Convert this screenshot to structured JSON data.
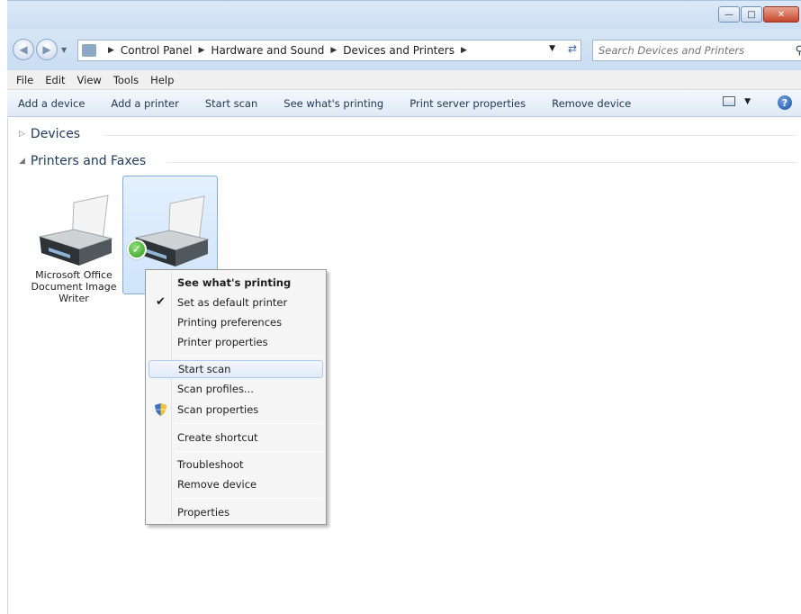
{
  "window": {
    "caption_buttons": [
      "minimize",
      "maximize",
      "close"
    ]
  },
  "address_bar": {
    "breadcrumbs": [
      "Control Panel",
      "Hardware and Sound",
      "Devices and Printers"
    ],
    "search_placeholder": "Search Devices and Printers"
  },
  "menubar": [
    "File",
    "Edit",
    "View",
    "Tools",
    "Help"
  ],
  "commandbar": {
    "items": [
      "Add a device",
      "Add a printer",
      "Start scan",
      "See what's printing",
      "Print server properties",
      "Remove device"
    ],
    "help_label": "?"
  },
  "groups": {
    "devices": "Devices",
    "printers": "Printers and Faxes"
  },
  "devices": [
    {
      "label": "Microsoft Office Document Image Writer",
      "selected": false,
      "default": false
    },
    {
      "label": "",
      "selected": true,
      "default": true
    }
  ],
  "context_menu": {
    "items": [
      {
        "label": "See what's printing",
        "bold": true
      },
      {
        "label": "Set as default printer",
        "checked": true
      },
      {
        "label": "Printing preferences"
      },
      {
        "label": "Printer properties"
      },
      {
        "label": "Start scan",
        "highlighted": true
      },
      {
        "label": "Scan profiles..."
      },
      {
        "label": "Scan properties",
        "icon": "shield-icon"
      },
      {
        "label": "Create shortcut"
      },
      {
        "label": "Troubleshoot"
      },
      {
        "label": "Remove device"
      },
      {
        "label": "Properties"
      }
    ]
  },
  "colors": {
    "accent": "#3a68a8",
    "selection": "#cfe4fb",
    "check_badge": "#2f9a1c"
  }
}
